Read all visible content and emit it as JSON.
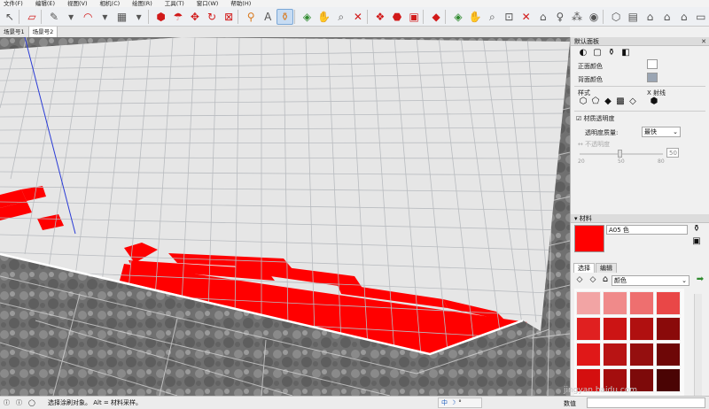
{
  "menu": [
    "文件(F)",
    "编辑(E)",
    "视图(V)",
    "相机(C)",
    "绘图(R)",
    "工具(T)",
    "窗口(W)",
    "帮助(H)"
  ],
  "scene_tabs": [
    "场景号1",
    "场景号2"
  ],
  "tray": {
    "title": "默认面板",
    "styles": {
      "front_color_label": "正面颜色",
      "back_color_label": "背面颜色",
      "front_color": "#ffffff",
      "back_color": "#9aa5b3",
      "style_label": "样式",
      "xray_label": "X 射线",
      "transparency_checkbox": "材质透明度",
      "quality_label": "透明度质量:",
      "quality_value": "最快",
      "opacity_label": "不透明度",
      "opacity_value": "50",
      "ticks": [
        "20",
        "50",
        "80"
      ]
    },
    "materials": {
      "title": "材料",
      "name": "A05 色",
      "current_color": "#ff0000",
      "tab_select": "选择",
      "tab_edit": "编辑",
      "library": "颜色",
      "swatches": [
        "#f2a4a4",
        "#f08a8a",
        "#ee6f6f",
        "#e94747",
        "#e02020",
        "#cc1414",
        "#b01010",
        "#8a0a0a",
        "#e01818",
        "#b81414",
        "#950f0f",
        "#6e0707",
        "#d40f0f",
        "#a30e0e",
        "#7d0a0a",
        "#4a0404"
      ]
    }
  },
  "status": {
    "message": "选择涂刷对象。 Alt = 材料采样。",
    "ime": [
      "中",
      "☽",
      "°"
    ],
    "value_label": "数值",
    "watermark": "jingyan.baidu.com"
  }
}
